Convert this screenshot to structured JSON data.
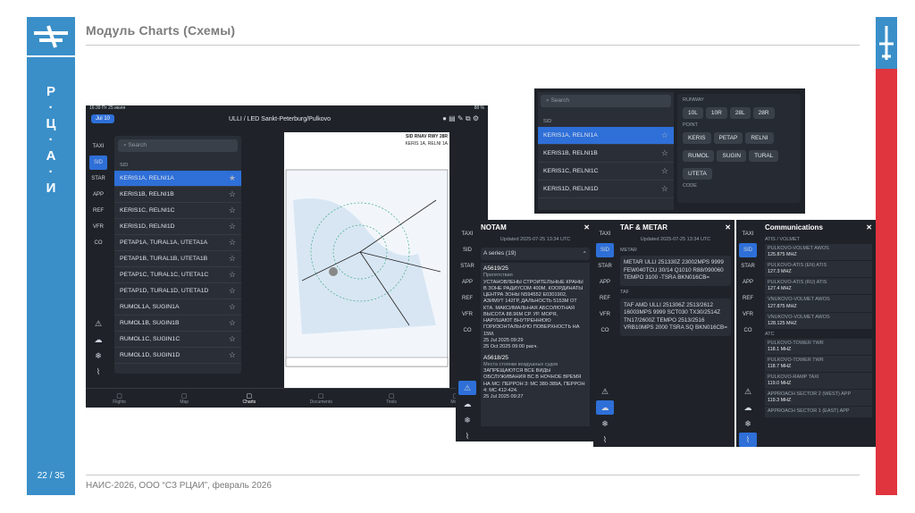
{
  "slide": {
    "title": "Модуль Charts (Схемы)",
    "footer": "НАИС-2026, ООО “СЗ РЦАИ”,  февраль 2026",
    "page": "22 / 35",
    "vertical_letters": [
      "Р",
      "·",
      "Ц",
      "·",
      "А",
      "·",
      "И"
    ]
  },
  "colors": {
    "left_bar": "#3a8fc9",
    "right_bar": "#e0343f",
    "app_bg": "#1f2329",
    "selected": "#2e6fd8"
  },
  "main_app": {
    "status_time": "16:39  Пт 25 июля",
    "battery": "88 %",
    "date_button": "Jul 10",
    "header": "ULLI / LED Sankt-Peterburg/Pulkovo",
    "rail": [
      "TAXI",
      "SID",
      "STAR",
      "APP",
      "REF",
      "VFR",
      "CO"
    ],
    "search_placeholder": "Search",
    "section": "SID",
    "procedures": [
      "KERIS1A, RELNI1A",
      "KERIS1B, RELNI1B",
      "KERIS1C, RELNI1C",
      "KERIS1D, RELNI1D",
      "PETAP1A, TURAL1A, UTETA1A",
      "PETAP1B, TURAL1B, UTETA1B",
      "PETAP1C, TURAL1C, UTETA1C",
      "PETAP1D, TURAL1D, UTETA1D",
      "RUMOL1A, SUGIN1A",
      "RUMOL1B, SUGIN1B",
      "RUMOL1C, SUGIN1C",
      "RUMOL1D, SUGIN1D"
    ],
    "tabs": [
      "Flights",
      "Map",
      "Charts",
      "Documents",
      "Tools",
      "More"
    ],
    "chart_header": "SID RNAV RWY 28R",
    "chart_sub": "KERIS 1A, RELNI 1A"
  },
  "filter_popup": {
    "search_placeholder": "Search",
    "section": "SID",
    "items": [
      "KERIS1A, RELNI1A",
      "KERIS1B, RELNI1B",
      "KERIS1C, RELNI1C",
      "KERIS1D, RELNI1D"
    ],
    "runway_label": "RUNWAY",
    "runways": [
      "10L",
      "10R",
      "28L",
      "28R"
    ],
    "point_label": "POINT",
    "points": [
      "KERIS",
      "PETAP",
      "RELNI",
      "RUMOL",
      "SUGIN",
      "TURAL",
      "UTETA"
    ],
    "code_label": "CODE"
  },
  "notam": {
    "title": "NOTAM",
    "updated": "Updated 2025-07-25 13:34 UTC",
    "series": "A series (19)",
    "items": [
      {
        "id": "A5619/25",
        "tags": [
          "IFR",
          "VFR",
          "A",
          "M"
        ],
        "cat": "Препятствия",
        "text": "УСТАНОВЛЕНЫ СТРОИТЕЛЬНЫЕ КРАНЫ В ЗОНЕ РАДИУСОМ 400М, КООРДИНАТЫ ЦЕНТРА ЗОНЫ N594552 E0301902, АЗИМУТ 142ГР, ДАЛЬНОСТЬ 5153М ОТ КТА. МАКСИМАЛЬНАЯ АБСОЛЮТНАЯ ВЫСОТА 88.96М СР. УР. МОРЯ, НАРУШАЮТ ВНУТРЕННЮЮ ГОРИЗОНТАЛЬНУЮ ПОВЕРХНОСТЬ НА 15М.",
        "d1": "25 Jul 2025 09:29",
        "d2": "25 Oct 2025 09:00 расч."
      },
      {
        "id": "A5618/25",
        "tags": [
          "IFR",
          "VFR",
          "A",
          "SO"
        ],
        "cat": "Места стоянки воздушных судов",
        "text": "ЗАПРЕЩАЮТСЯ ВСЕ ВИДЫ ОБСЛУЖИВАНИЯ ВС В НОЧНОЕ ВРЕМЯ НА МС: ПЕРРОН 3: МС 380-389А, ПЕРРОН 4: МС 412-424.",
        "d1": "25 Jul 2025 09:27"
      }
    ],
    "rail": [
      "TAXI",
      "SID",
      "STAR",
      "APP",
      "REF",
      "VFR",
      "CO"
    ]
  },
  "taf": {
    "title": "TAF & METAR",
    "updated": "Updated 2025-07-25 13:34 UTC",
    "metar_label": "METAR",
    "metar": "METAR ULLI 251330Z 23002MPS 9999 FEW040TCU 30/14 Q1010 R88/090060 TEMPO 3100 -TSRA BKN016CB=",
    "taf_label": "TAF",
    "taf": "TAF AMD ULLI 251306Z 2513/2612 16003MPS 9999 SCT030 TX30/2514Z TN17/2600Z TEMPO 2513/2516 VRB10MPS 2000 TSRA SQ BKN016CB=",
    "rail": [
      "TAXI",
      "SID",
      "STAR",
      "APP",
      "REF",
      "VFR",
      "CO"
    ]
  },
  "comms": {
    "title": "Communications",
    "atis_label": "ATIS / VOLMET",
    "atis": [
      [
        "PULKOVO-VOLMET AWOS",
        "125.875 MHZ"
      ],
      [
        "PULKOVO-ATIS (EN) ATIS",
        "127.3 MHZ"
      ],
      [
        "PULKOVO-ATIS (RU) ATIS",
        "127.4 MHZ"
      ],
      [
        "VNUKOVO-VOLMET AWOS",
        "127.875 MHZ"
      ],
      [
        "VNUKOVO-VOLMET AWOS",
        "128.125 MHZ"
      ]
    ],
    "atc_label": "ATC",
    "atc": [
      [
        "PULKOVO-TOWER TWR",
        "118.1 MHZ"
      ],
      [
        "PULKOVO-TOWER TWR",
        "118.7 MHZ"
      ],
      [
        "PULKOVO-RAMP TAXI",
        "119.0 MHZ"
      ],
      [
        "APPROACH SECTOR 2 (WEST) APP",
        "119.3 MHZ"
      ],
      [
        "APPROACH SECTOR 1 (EAST) APP",
        ""
      ]
    ],
    "rail": [
      "TAXI",
      "SID",
      "STAR",
      "APP",
      "REF",
      "VFR",
      "CO"
    ]
  }
}
